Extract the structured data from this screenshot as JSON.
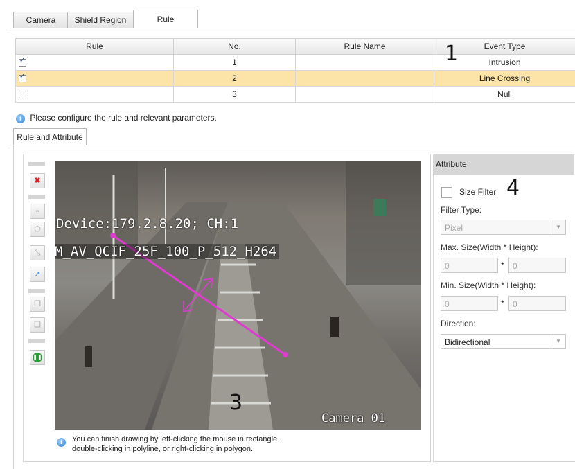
{
  "tabs": [
    {
      "label": "Camera"
    },
    {
      "label": "Shield Region"
    },
    {
      "label": "Rule"
    }
  ],
  "rule_table": {
    "headers": [
      "Rule",
      "No.",
      "Rule Name",
      "Event Type"
    ],
    "rows": [
      {
        "checked": true,
        "no": "1",
        "name": "",
        "event": "Intrusion",
        "selected": false
      },
      {
        "checked": true,
        "no": "2",
        "name": "",
        "event": "Line Crossing",
        "selected": true
      },
      {
        "checked": false,
        "no": "3",
        "name": "",
        "event": "Null",
        "selected": false
      }
    ]
  },
  "info_text": "Please configure the  rule and relevant parameters.",
  "subtab": {
    "label": "Rule and Attribute"
  },
  "video": {
    "osd_device": "Device:179.2.8.20; CH:1",
    "osd_stream": "M_AV_QCIF_25F_100_P_512_H264",
    "osd_camera": "Camera 01"
  },
  "hint_text_1": "You can finish drawing by left-clicking the mouse in rectangle,",
  "hint_text_2": "double-clicking in polyline, or right-clicking in polygon.",
  "attribute": {
    "title": "Attribute",
    "size_filter_label": "Size Filter",
    "size_filter_checked": false,
    "filter_type_label": "Filter Type:",
    "filter_type_value": "Pixel",
    "max_size_label": "Max. Size(Width * Height):",
    "max_w": "0",
    "max_h": "0",
    "min_size_label": "Min. Size(Width * Height):",
    "min_w": "0",
    "min_h": "0",
    "times": "*",
    "direction_label": "Direction:",
    "direction_value": "Bidirectional"
  },
  "annotations": {
    "n1": "1",
    "n3": "3",
    "n4": "4"
  },
  "colors": {
    "selected_row": "#fce4a8",
    "line_color": "#e03ad0",
    "accent_icon": "#2d7fd1"
  }
}
